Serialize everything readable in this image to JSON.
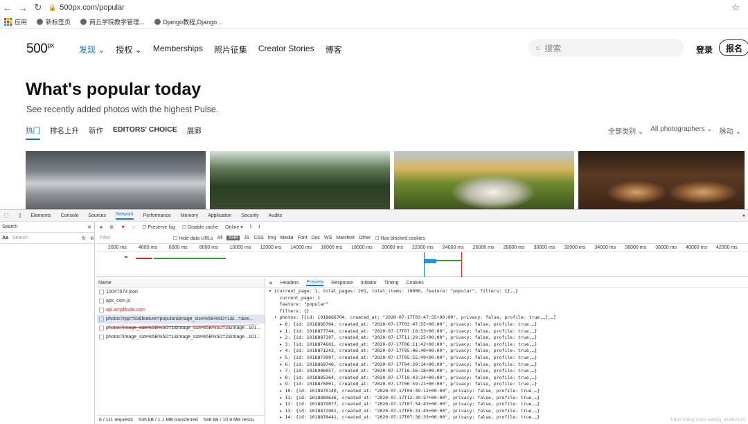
{
  "browser": {
    "url": "500px.com/popular",
    "bookmarks": [
      "应用",
      "新标签页",
      "商丘学院教学管理...",
      "Django教程,Django..."
    ]
  },
  "site": {
    "logo": "500",
    "logo_sup": "px",
    "nav": [
      "发现",
      "授权",
      "Memberships",
      "照片征集",
      "Creator Stories",
      "博客"
    ],
    "search_placeholder": "搜索",
    "login": "登录",
    "signup": "报名",
    "title": "What's popular today",
    "subtitle": "See recently added photos with the highest Pulse.",
    "tabs": [
      "热门",
      "排名上升",
      "新作",
      "EDITORS' CHOICE",
      "展廊"
    ],
    "filters": [
      "全部类别",
      "All photographers",
      "脉动"
    ]
  },
  "devtools": {
    "tabs": [
      "Elements",
      "Console",
      "Sources",
      "Network",
      "Performance",
      "Memory",
      "Application",
      "Security",
      "Audits"
    ],
    "search_label": "Search",
    "search_placeholder": "Search",
    "aa": "Aa",
    "preserve_log": "Preserve log",
    "disable_cache": "Disable cache",
    "throttle": "Online",
    "filter_placeholder": "Filter",
    "hide_data_urls": "Hide data URLs",
    "filter_types": [
      "All",
      "XHR",
      "JS",
      "CSS",
      "Img",
      "Media",
      "Font",
      "Doc",
      "WS",
      "Manifest",
      "Other"
    ],
    "blocked_cookies": "Has blocked cookies",
    "ticks": [
      "2000 ms",
      "4000 ms",
      "6000 ms",
      "8000 ms",
      "10000 ms",
      "12000 ms",
      "14000 ms",
      "16000 ms",
      "18000 ms",
      "20000 ms",
      "22000 ms",
      "24000 ms",
      "26000 ms",
      "28000 ms",
      "30000 ms",
      "32000 ms",
      "34000 ms",
      "36000 ms",
      "38000 ms",
      "40000 ms",
      "42000 ms"
    ],
    "name_header": "Name",
    "requests": [
      "10047574.json",
      "aps_csm.js",
      "api.amplitude.com",
      "photos?rpp=50&feature=popular&image_size%5B%5D=1&i...=&ex...",
      "photos?image_size%5B%5D=1&image_size%5B%5D=2&image...101...",
      "photos?image_size%5B%5D=1&image_size%5B%5D=2&image...101..."
    ],
    "footer": [
      "6 / 111 requests",
      "535 kB / 1.1 MB transferred",
      "538 kB / 10.9 MB resou"
    ],
    "preview_tabs": [
      "Headers",
      "Preview",
      "Response",
      "Initiator",
      "Timing",
      "Cookies"
    ],
    "preview_lines": [
      "▾ {current_page: 1, total_pages: 201, total_items: 10000, feature: \"popular\", filters: {},…}",
      "    current_page: 1",
      "    feature: \"popular\"",
      "    filters: {}",
      "  ▾ photos: [{id: 1018866704, created_at: \"2020-07-17T03:47:55+00:00\", privacy: false, profile: true,…},…]",
      "    ▸ 0: {id: 1018866704, created_at: \"2020-07-17T03:47:55+00:00\", privacy: false, profile: true,…}",
      "    ▸ 1: {id: 1018877744, created_at: \"2020-07-17T07:18:53+00:00\", privacy: false, profile: true,…}",
      "    ▸ 2: {id: 1018887397, created_at: \"2020-07-17T11:29:25+00:00\", privacy: false, profile: true,…}",
      "    ▸ 3: {id: 1018874601, created_at: \"2020-07-17T06:11:42+00:00\", privacy: false, profile: true,…}",
      "    ▸ 4: {id: 1018871242, created_at: \"2020-07-17T05:06:40+00:00\", privacy: false, profile: true,…}",
      "    ▸ 5: {id: 1018873997, created_at: \"2020-07-17T05:55:49+00:00\", privacy: false, profile: true,…}",
      "    ▸ 6: {id: 1018868746, created_at: \"2020-07-17T04:20:14+00:00\", privacy: false, profile: true,…}",
      "    ▸ 7: {id: 1018906057, created_at: \"2020-07-17T16:56:18+00:00\", privacy: false, profile: true,…}",
      "    ▸ 8: {id: 1018885364, created_at: \"2020-07-17T10:43:24+00:00\", privacy: false, profile: true,…}",
      "    ▸ 9: {id: 1018876001, created_at: \"2020-07-17T06:59:21+00:00\", privacy: false, profile: true,…}",
      "    ▸ 10: {id: 1018870140, created_at: \"2020-07-17T04:49:12+00:00\", privacy: false, profile: true,…}",
      "    ▸ 11: {id: 1018889636, created_at: \"2020-07-17T12:39:57+00:00\", privacy: false, profile: true,…}",
      "    ▸ 12: {id: 1018879077, created_at: \"2020-07-17T07:54:43+00:00\", privacy: false, profile: true,…}",
      "    ▸ 13: {id: 1018872961, created_at: \"2020-07-17T05:31:45+00:00\", privacy: false, profile: true,…}",
      "    ▸ 14: {id: 1018878441, created_at: \"2020-07-17T07:38:35+00:00\", privacy: false, profile: true,…}"
    ],
    "watermark": "https://blog.csdn.net/qq_41862120"
  },
  "colors": {
    "accent": "#0870d1",
    "devtools_accent": "#1a73e8",
    "redline": "#e1251b"
  }
}
